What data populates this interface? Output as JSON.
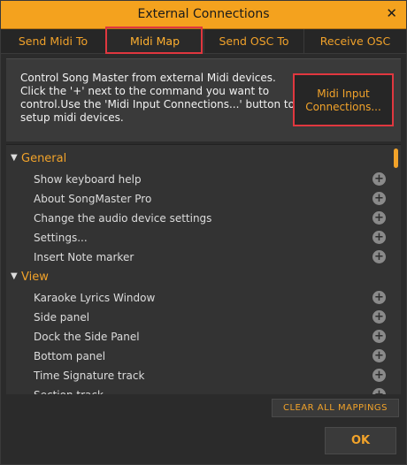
{
  "window": {
    "title": "External Connections",
    "close_glyph": "✕"
  },
  "tabs": [
    {
      "label": "Send Midi To"
    },
    {
      "label": "Midi Map"
    },
    {
      "label": "Send OSC To"
    },
    {
      "label": "Receive OSC"
    }
  ],
  "active_tab": "Midi Map",
  "info": {
    "line1": "Control Song Master from external Midi devices.",
    "line2": "Click the '+' next to the command you want to",
    "line3": "control.Use the 'Midi Input Connections...' button to",
    "line4": "setup midi devices."
  },
  "midi_button": {
    "line1": "Midi Input",
    "line2": "Connections..."
  },
  "sections": [
    {
      "label": "General",
      "items": [
        {
          "label": "Show keyboard help"
        },
        {
          "label": "About SongMaster Pro"
        },
        {
          "label": "Change the audio device settings"
        },
        {
          "label": "Settings..."
        },
        {
          "label": "Insert Note marker"
        }
      ]
    },
    {
      "label": "View",
      "items": [
        {
          "label": "Karaoke Lyrics Window"
        },
        {
          "label": "Side panel"
        },
        {
          "label": "Dock the Side Panel"
        },
        {
          "label": "Bottom panel"
        },
        {
          "label": "Time Signature track"
        },
        {
          "label": "Section track"
        }
      ]
    }
  ],
  "buttons": {
    "clear_all": "CLEAR ALL MAPPINGS",
    "ok": "OK"
  },
  "colors": {
    "accent": "#f2a32a",
    "titlebar": "#f4a21e",
    "highlight": "#e0373f"
  }
}
